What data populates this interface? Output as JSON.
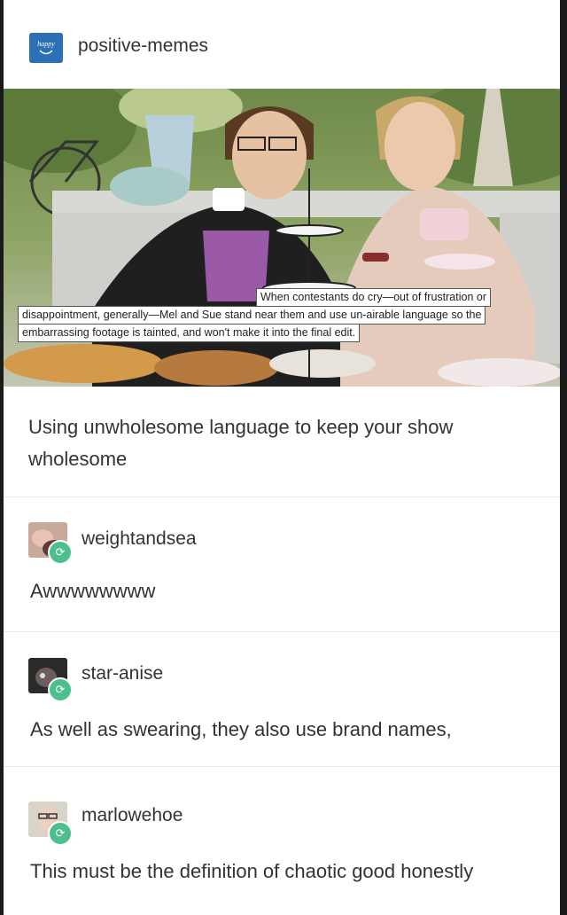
{
  "header": {
    "blog_avatar_text": "happy",
    "blog_name": "positive-memes"
  },
  "photo": {
    "caption_line1": "When contestants do cry—out of frustration or",
    "caption_line2": "disappointment, generally—Mel and Sue stand near them and use un-airable language so the",
    "caption_line3": "embarrassing footage is tainted, and won't make it into the final edit."
  },
  "post": {
    "text": "Using unwholesome language to keep your show wholesome"
  },
  "reblogs": [
    {
      "username": "weightandsea",
      "text": "Awwwwwwww"
    },
    {
      "username": "star-anise",
      "text": "As well as swearing, they also use brand names,"
    },
    {
      "username": "marlowehoe",
      "text": "This must be the definition of chaotic good honestly"
    }
  ],
  "colors": {
    "blog_avatar": "#2b6fb6",
    "reblog_badge": "#4cbf8c"
  }
}
